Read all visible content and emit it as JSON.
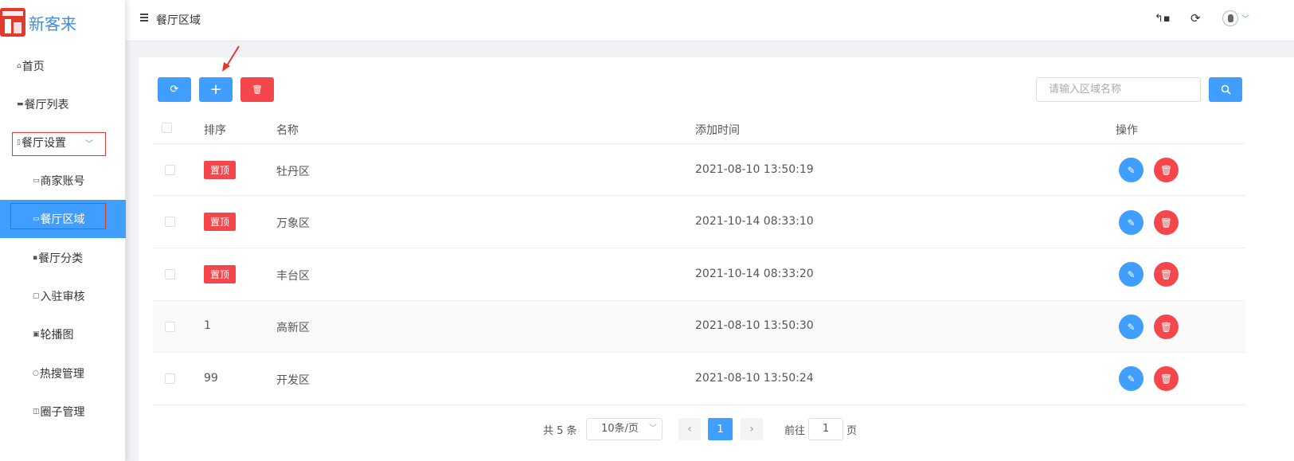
{
  "app": {
    "logo_text": "新客来"
  },
  "sidebar": {
    "items": [
      {
        "label": "首页",
        "icon": "home-icon"
      },
      {
        "label": "餐厅列表",
        "icon": "list-icon"
      },
      {
        "label": "餐厅设置",
        "icon": "settings-doc-icon",
        "expanded": true
      },
      {
        "label": "商家账号",
        "icon": "card-icon"
      },
      {
        "label": "餐厅区域",
        "icon": "card-icon",
        "active": true
      },
      {
        "label": "餐厅分类",
        "icon": "grid-icon"
      },
      {
        "label": "入驻审核",
        "icon": "review-icon"
      },
      {
        "label": "轮播图",
        "icon": "image-icon"
      },
      {
        "label": "热搜管理",
        "icon": "search-icon"
      },
      {
        "label": "圈子管理",
        "icon": "circle-icon"
      }
    ]
  },
  "header": {
    "title": "餐厅区域"
  },
  "toolbar": {
    "refresh_label": "⟳",
    "add_label": "+",
    "delete_label": "🗑",
    "search_placeholder": "请输入区域名称"
  },
  "table": {
    "columns": [
      "排序",
      "名称",
      "添加时间",
      "操作"
    ],
    "rows": [
      {
        "sort": "置顶",
        "is_top": true,
        "name": "牡丹区",
        "time": "2021-08-10 13:50:19"
      },
      {
        "sort": "置顶",
        "is_top": true,
        "name": "万象区",
        "time": "2021-10-14 08:33:10"
      },
      {
        "sort": "置顶",
        "is_top": true,
        "name": "丰台区",
        "time": "2021-10-14 08:33:20"
      },
      {
        "sort": "1",
        "is_top": false,
        "name": "高新区",
        "time": "2021-08-10 13:50:30"
      },
      {
        "sort": "99",
        "is_top": false,
        "name": "开发区",
        "time": "2021-08-10 13:50:24"
      }
    ]
  },
  "pagination": {
    "total_text": "共 5 条",
    "page_size": "10条/页",
    "current_page": "1",
    "goto_label": "前往",
    "goto_value": "1",
    "page_suffix": "页"
  },
  "colors": {
    "primary": "#409eff",
    "danger": "#f5474b",
    "highlight_box": "#e23b2e"
  }
}
